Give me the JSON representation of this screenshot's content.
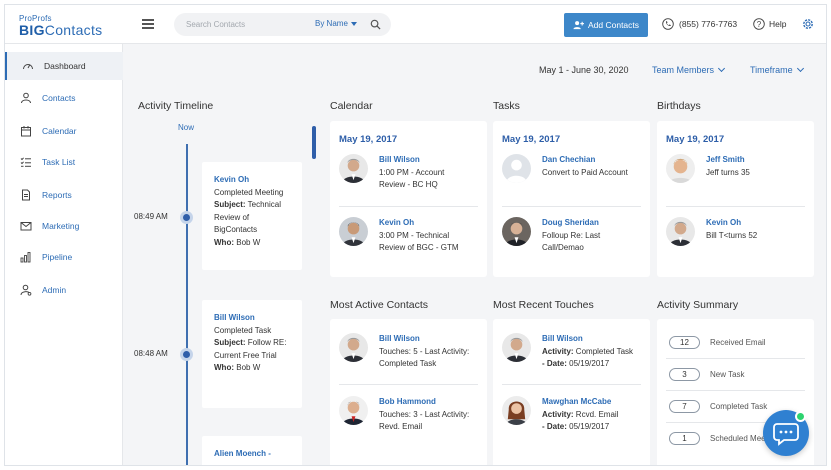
{
  "logo": {
    "top": "ProProfs",
    "main_a": "BIG",
    "main_b": "Contacts"
  },
  "search": {
    "placeholder": "Search Contacts",
    "filter": "By Name"
  },
  "header": {
    "add_contacts": "Add Contacts",
    "phone": "(855) 776-7763",
    "help": "Help"
  },
  "sidebar": {
    "items": [
      {
        "label": "Dashboard",
        "icon": "speedometer-icon"
      },
      {
        "label": "Contacts",
        "icon": "person-icon"
      },
      {
        "label": "Calendar",
        "icon": "calendar-icon"
      },
      {
        "label": "Task List",
        "icon": "checklist-icon"
      },
      {
        "label": "Reports",
        "icon": "document-icon"
      },
      {
        "label": "Marketing",
        "icon": "envelope-icon"
      },
      {
        "label": "Pipeline",
        "icon": "bar-chart-icon"
      },
      {
        "label": "Admin",
        "icon": "admin-person-icon"
      }
    ]
  },
  "toolbar": {
    "date_range": "May 1 - June 30, 2020",
    "team_members": "Team Members",
    "timeframe": "Timeframe"
  },
  "timeline": {
    "title": "Activity Timeline",
    "now": "Now",
    "entries": [
      {
        "time": "08:49 AM",
        "name": "Kevin Oh",
        "l1": "Completed Meeting",
        "subject_label": "Subject:",
        "subject": "Technical Review of BigContacts",
        "subject_a": " Technical",
        "subject_b": "Review of",
        "subject_c": "BigContacts",
        "who_label": "Who:",
        "who": "Bob W"
      },
      {
        "time": "08:48 AM",
        "name": "Bill Wilson",
        "l1": "Completed Task",
        "subject_label": "Subject:",
        "subject_a": " Follow RE:",
        "subject_b": "Current Free Trial",
        "who_label": "Who:",
        "who": "Bob W"
      },
      {
        "name": "Alien Moench -"
      }
    ]
  },
  "calendar": {
    "title": "Calendar",
    "date": "May 19, 2017",
    "items": [
      {
        "name": "Bill Wilson",
        "line1": "1:00 PM - Account",
        "line2": "Review - BC HQ"
      },
      {
        "name": "Kevin Oh",
        "line1": "3:00 PM - Technical",
        "line2": "Review of BGC - GTM"
      }
    ]
  },
  "tasks": {
    "title": "Tasks",
    "date": "May 19, 2017",
    "items": [
      {
        "name": "Dan Chechian",
        "line1": "Convert to Paid Account"
      },
      {
        "name": "Doug Sheridan",
        "line1": "Folloup Re: Last",
        "line2": "Call/Demao"
      }
    ]
  },
  "birthdays": {
    "title": "Birthdays",
    "date": "May 19, 2017",
    "items": [
      {
        "name": "Jeff Smith",
        "line1": "Jeff turns 35"
      },
      {
        "name": "Kevin Oh",
        "line1": "Bill T<turns 52"
      }
    ]
  },
  "most_active": {
    "title": "Most Active Contacts",
    "items": [
      {
        "name": "Bill Wilson",
        "line1": "Touches: 5 - Last Activity:",
        "line2": "Completed Task"
      },
      {
        "name": "Bob Hammond",
        "line1": "Touches: 3 - Last Activity:",
        "line2": "Revd. Email"
      }
    ]
  },
  "recent_touches": {
    "title": "Most Recent Touches",
    "items": [
      {
        "name": "Bill Wilson",
        "activity_label": "Activity:",
        "activity": "Completed Task",
        "date_label": "- Date:",
        "date": "05/19/2017"
      },
      {
        "name": "Mawghan McCabe",
        "activity_label": "Activity:",
        "activity": "Rcvd. Email",
        "date_label": "- Date:",
        "date": "05/19/2017"
      }
    ]
  },
  "activity_summary": {
    "title": "Activity Summary",
    "rows": [
      {
        "count": "12",
        "label": "Received Email"
      },
      {
        "count": "3",
        "label": "New Task"
      },
      {
        "count": "7",
        "label": "Completed Task"
      },
      {
        "count": "1",
        "label": "Scheduled Mee"
      }
    ]
  },
  "colors": {
    "brand": "#2d6cb5",
    "accent_button": "#3d87c9",
    "chat": "#2f80d1",
    "online": "#2dd36f"
  }
}
